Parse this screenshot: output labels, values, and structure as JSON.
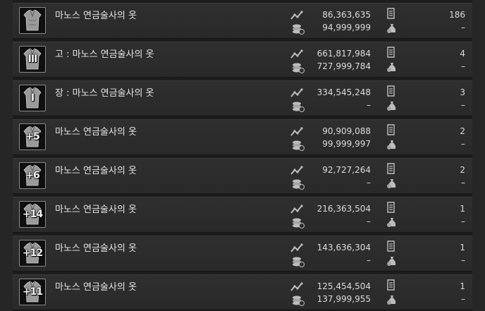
{
  "items": [
    {
      "name": "마노스 연금술사의 옷",
      "enhance": "",
      "badge": "",
      "price": "86,363,635",
      "max_price": "94,999,999",
      "count": "186",
      "stock": "–"
    },
    {
      "name": "고 : 마노스 연금술사의 옷",
      "enhance": "",
      "badge": "III",
      "price": "661,817,984",
      "max_price": "727,999,784",
      "count": "4",
      "stock": "–"
    },
    {
      "name": "장 : 마노스 연금술사의 옷",
      "enhance": "",
      "badge": "I",
      "price": "334,545,248",
      "max_price": "–",
      "count": "3",
      "stock": "–"
    },
    {
      "name": "마노스 연금술사의 옷",
      "enhance": "+5",
      "badge": "",
      "price": "90,909,088",
      "max_price": "99,999,997",
      "count": "2",
      "stock": "–"
    },
    {
      "name": "마노스 연금술사의 옷",
      "enhance": "+6",
      "badge": "",
      "price": "92,727,264",
      "max_price": "–",
      "count": "2",
      "stock": "–"
    },
    {
      "name": "마노스 연금술사의 옷",
      "enhance": "+14",
      "badge": "",
      "price": "216,363,504",
      "max_price": "–",
      "count": "1",
      "stock": "–"
    },
    {
      "name": "마노스 연금술사의 옷",
      "enhance": "+12",
      "badge": "",
      "price": "143,636,304",
      "max_price": "–",
      "count": "1",
      "stock": "–"
    },
    {
      "name": "마노스 연금술사의 옷",
      "enhance": "+11",
      "badge": "",
      "price": "125,454,504",
      "max_price": "137,999,955",
      "count": "1",
      "stock": "–"
    }
  ],
  "icons": {
    "trend": "price-trend-icon",
    "coins": "silver-coins-icon",
    "doc": "registration-doc-icon",
    "bag": "money-bag-icon"
  },
  "colors": {
    "row_bg": "#2c2c2c",
    "text": "#dcdcdc",
    "slot_border": "#8a8a8a"
  }
}
